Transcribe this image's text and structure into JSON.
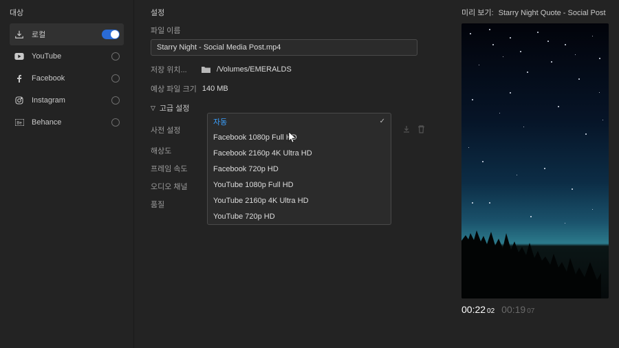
{
  "sidebar": {
    "title": "대상",
    "items": [
      {
        "icon": "export",
        "label": "로컬",
        "active": true,
        "control": "toggle"
      },
      {
        "icon": "youtube",
        "label": "YouTube",
        "control": "radio"
      },
      {
        "icon": "facebook",
        "label": "Facebook",
        "control": "radio"
      },
      {
        "icon": "instagram",
        "label": "Instagram",
        "control": "radio"
      },
      {
        "icon": "behance",
        "label": "Behance",
        "control": "radio"
      }
    ]
  },
  "settings": {
    "title": "설정",
    "filename_label": "파일 이름",
    "filename": "Starry Night - Social Media Post.mp4",
    "save_loc_label": "저장 위치...",
    "save_loc_path": "/Volumes/EMERALDS",
    "est_size_label": "예상 파일 크기",
    "est_size_value": "140 MB",
    "advanced_label": "고급 설정",
    "rows": {
      "preset": "사전 설정",
      "resolution": "해상도",
      "framerate": "프레임 속도",
      "audio": "오디오 채널",
      "quality": "품질"
    },
    "preset_value": "자동",
    "options": [
      "자동",
      "Facebook 1080p Full HD",
      "Facebook 2160p 4K Ultra HD",
      "Facebook 720p HD",
      "YouTube 1080p Full HD",
      "YouTube 2160p 4K Ultra HD",
      "YouTube 720p HD"
    ]
  },
  "preview": {
    "label": "미리 보기:",
    "name": "Starry Night Quote - Social Post",
    "time_a": "00:22",
    "time_a_f": "02",
    "time_b": "00:19",
    "time_b_f": "07"
  }
}
